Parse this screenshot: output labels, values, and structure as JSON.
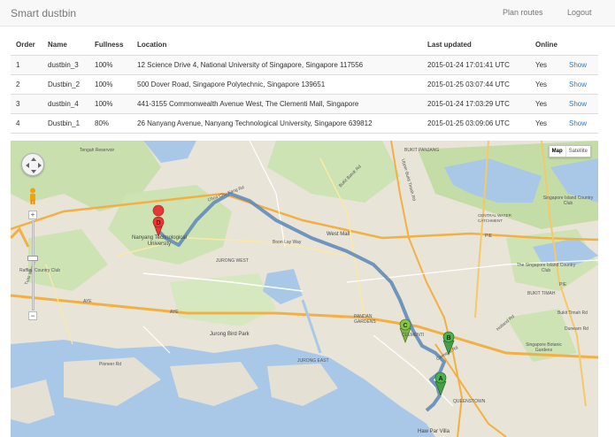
{
  "navbar": {
    "brand": "Smart dustbin",
    "plan_routes": "Plan routes",
    "logout": "Logout"
  },
  "table": {
    "headers": [
      "Order",
      "Name",
      "Fullness",
      "Location",
      "Last updated",
      "Online",
      ""
    ],
    "rows": [
      {
        "order": "1",
        "name": "dustbin_3",
        "fullness": "100%",
        "location": "12 Science Drive 4, National University of Singapore, Singapore 117556",
        "updated": "2015-01-24 17:01:41 UTC",
        "online": "Yes",
        "action": "Show"
      },
      {
        "order": "2",
        "name": "Dustbin_2",
        "fullness": "100%",
        "location": "500 Dover Road, Singapore Polytechnic, Singapore 139651",
        "updated": "2015-01-25 03:07:44 UTC",
        "online": "Yes",
        "action": "Show"
      },
      {
        "order": "3",
        "name": "dustbin_4",
        "fullness": "100%",
        "location": "441-3155 Commonwealth Avenue West, The Clementi Mall, Singapore",
        "updated": "2015-01-24 17:03:29 UTC",
        "online": "Yes",
        "action": "Show"
      },
      {
        "order": "4",
        "name": "Dustbin_1",
        "fullness": "80%",
        "location": "26 Nanyang Avenue, Nanyang Technological University, Singapore 639812",
        "updated": "2015-01-25 03:09:06 UTC",
        "online": "Yes",
        "action": "Show"
      }
    ]
  },
  "map": {
    "map_type": {
      "map": "Map",
      "satellite": "Satellite"
    },
    "zoom": {
      "plus": "+",
      "minus": "−"
    },
    "markers": [
      {
        "letter": "A",
        "color": "#4caf50"
      },
      {
        "letter": "B",
        "color": "#4caf50"
      },
      {
        "letter": "C",
        "color": "#8bc34a"
      },
      {
        "letter": "D",
        "color": "#e53935"
      }
    ],
    "labels": {
      "tengah": "Tengah Reservoir",
      "nanyang": "Nanyang Technological University",
      "raffles": "Raffles Country Club",
      "jurong_west": "JURONG WEST",
      "boon_lay": "Boon Lay Way",
      "west_mall": "West Mall",
      "bukit_panjang": "BUKIT PANJANG",
      "central_water": "CENTRAL WATER CATCHMENT",
      "sg_island_cc": "Singapore Island Country Club",
      "island_cc": "The Singapore Island Country Club",
      "bukit_timah": "BUKIT TIMAH",
      "botanic": "Singapore Botanic Gardens",
      "clementi": "CLEMENTI",
      "queenstown": "QUEENSTOWN",
      "pandan": "PANDAN GARDENS",
      "jurong_bird": "Jurong Bird Park",
      "jurong_east": "JURONG EAST",
      "haw_par": "Haw Par Villa",
      "aye": "AYE",
      "pie": "PIE",
      "tuas": "Tuas West Rd",
      "pioneer": "Pioneer Rd",
      "bukit_timah_rd": "Bukit Timah Rd",
      "dunearn": "Dunearn Rd",
      "holland": "Holland Rd",
      "clementi_rd": "Clementi Rd",
      "upper_bukit": "Upper Bukit Timah Rd",
      "bukit_batok": "Bukit Batok Rd",
      "choa": "Choa Chu Kang Rd"
    }
  }
}
